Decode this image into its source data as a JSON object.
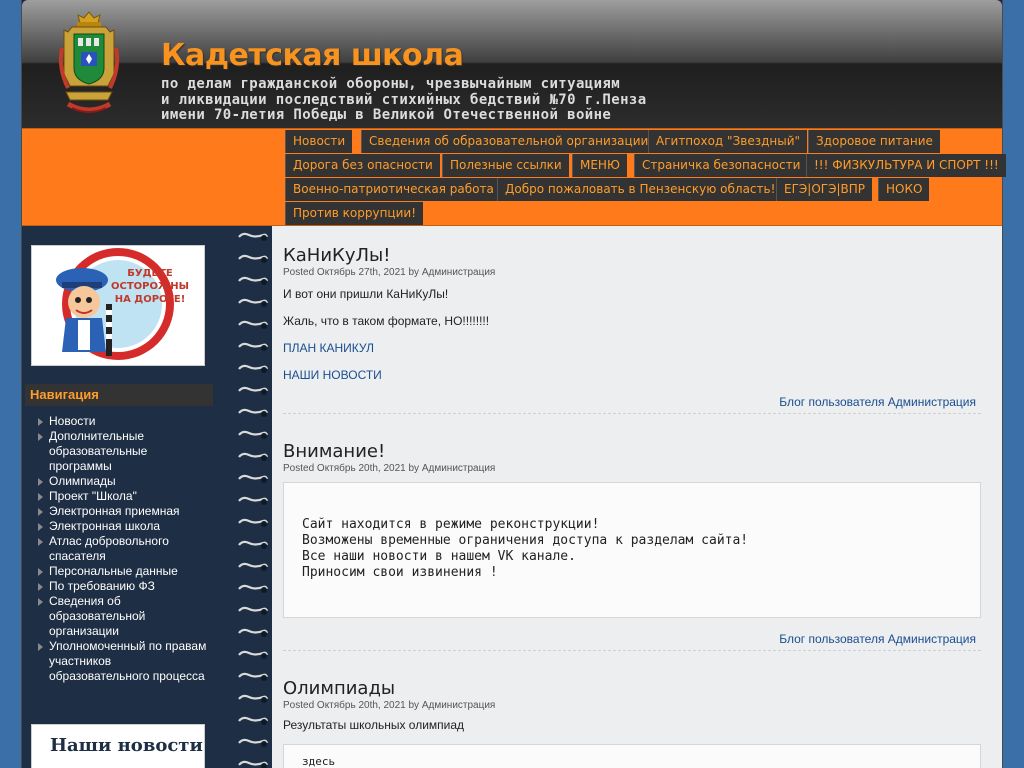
{
  "header": {
    "title": "Кадетская школа",
    "slogan_lines": [
      "по делам гражданской обороны, чрезвычайным ситуациям",
      "и ликвидации последствий стихийных бедствий №70 г.Пенза",
      "имени 70-летия Победы в Великой Отечественной войне"
    ],
    "crest_icon": "coat-of-arms-icon"
  },
  "menu": [
    "Новости",
    "Сведения об образовательной организации",
    "Агитпоход \"Звездный\"",
    "Здоровое питание",
    "Дорога без опасности",
    "Полезные ссылки",
    "МЕНЮ",
    "Страничка безопасности",
    "!!! ФИЗКУЛЬТУРА И СПОРТ !!!",
    "Военно-патриотическая работа",
    "Добро пожаловать в Пензенскую область!",
    "ЕГЭ|ОГЭ|ВПР",
    "НОКО",
    "Против коррупции!"
  ],
  "sidebar": {
    "banner_text": "БУДЬТЕ ОСТОРОЖНЫ НА ДОРОГЕ!",
    "nav_title": "Навигация",
    "nav_items": [
      "Новости",
      "Дополнительные образовательные программы",
      "Олимпиады",
      "Проект \"Школа\"",
      "Электронная приемная",
      "Электронная школа",
      "Атлас добровольного спасателя",
      "Персональные данные",
      "По требованию ФЗ",
      "Сведения об образовательной организации",
      "Уполномоченный по правам участников образовательного процесса"
    ],
    "news_banner": "Наши новости"
  },
  "posts": [
    {
      "title": "КаНиКуЛы!",
      "meta": "Posted Октябрь 27th, 2021 by Администрация",
      "paragraphs": [
        "И вот они пришли КаНиКуЛы!",
        "Жаль, что в таком формате, НО!!!!!!!!"
      ],
      "links": [
        "ПЛАН КАНИКУЛ",
        "НАШИ НОВОСТИ"
      ],
      "blog_link": "Блог пользователя Администрация"
    },
    {
      "title": "Внимание!",
      "meta": "Posted Октябрь 20th, 2021 by Администрация",
      "code_lines": [
        "Сайт находится в режиме реконструкции!",
        "Возможены временные ограничения доступа к разделам сайта!",
        "Все наши новости в нашем VK канале.",
        "Приносим свои извинения !"
      ],
      "blog_link": "Блог пользователя Администрация"
    },
    {
      "title": "Олимпиады",
      "meta": "Posted Октябрь 20th, 2021 by Администрация",
      "paragraphs": [
        "Результаты школьных олимпиад"
      ],
      "code_lines": [
        "здесь"
      ]
    }
  ],
  "colors": {
    "accent": "#ff7a1a",
    "menu_bg": "#333333",
    "menu_text": "#ff9c2a",
    "link": "#1a4e91"
  }
}
